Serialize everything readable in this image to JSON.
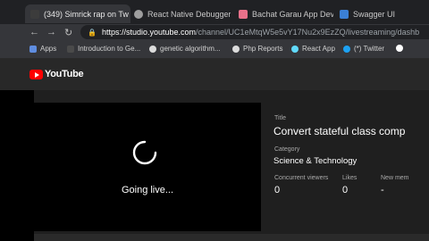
{
  "browser": {
    "tabs": [
      {
        "title": "(349) Simrick rap on Tw",
        "favicon_color": "#3c3c3c"
      },
      {
        "title": "React Native Debugger",
        "favicon_color": "#9e9e9e"
      },
      {
        "title": "Bachat Garau App Dev",
        "favicon_color": "#e8718a"
      },
      {
        "title": "Swagger UI",
        "favicon_color": "#3b7fd4"
      }
    ],
    "url_host": "https://studio.youtube.com",
    "url_path": "/channel/UC1eMtqW5e5vY17Nu2x9EzZQ/livestreaming/dashb",
    "bookmarks": [
      {
        "label": "Apps",
        "icon_color": "#5f8de0"
      },
      {
        "label": "Introduction to Ge...",
        "icon_color": "#4a4a4a"
      },
      {
        "label": "genetic algorithm...",
        "icon_color": "#dcdcdc"
      },
      {
        "label": "Php Reports",
        "icon_color": "#dcdcdc"
      },
      {
        "label": "React App",
        "icon_color": "#61dafb"
      },
      {
        "label": "(*) Twitter",
        "icon_color": "#1da1f2"
      }
    ]
  },
  "youtube": {
    "logo_text": "YouTube"
  },
  "stream": {
    "status_text": "Going live...",
    "title_label": "Title",
    "title_value": "Convert stateful class comp",
    "category_label": "Category",
    "category_value": "Science & Technology",
    "stats": [
      {
        "label": "Concurrent viewers",
        "value": "0"
      },
      {
        "label": "Likes",
        "value": "0"
      },
      {
        "label": "New mem",
        "value": "-"
      }
    ]
  }
}
